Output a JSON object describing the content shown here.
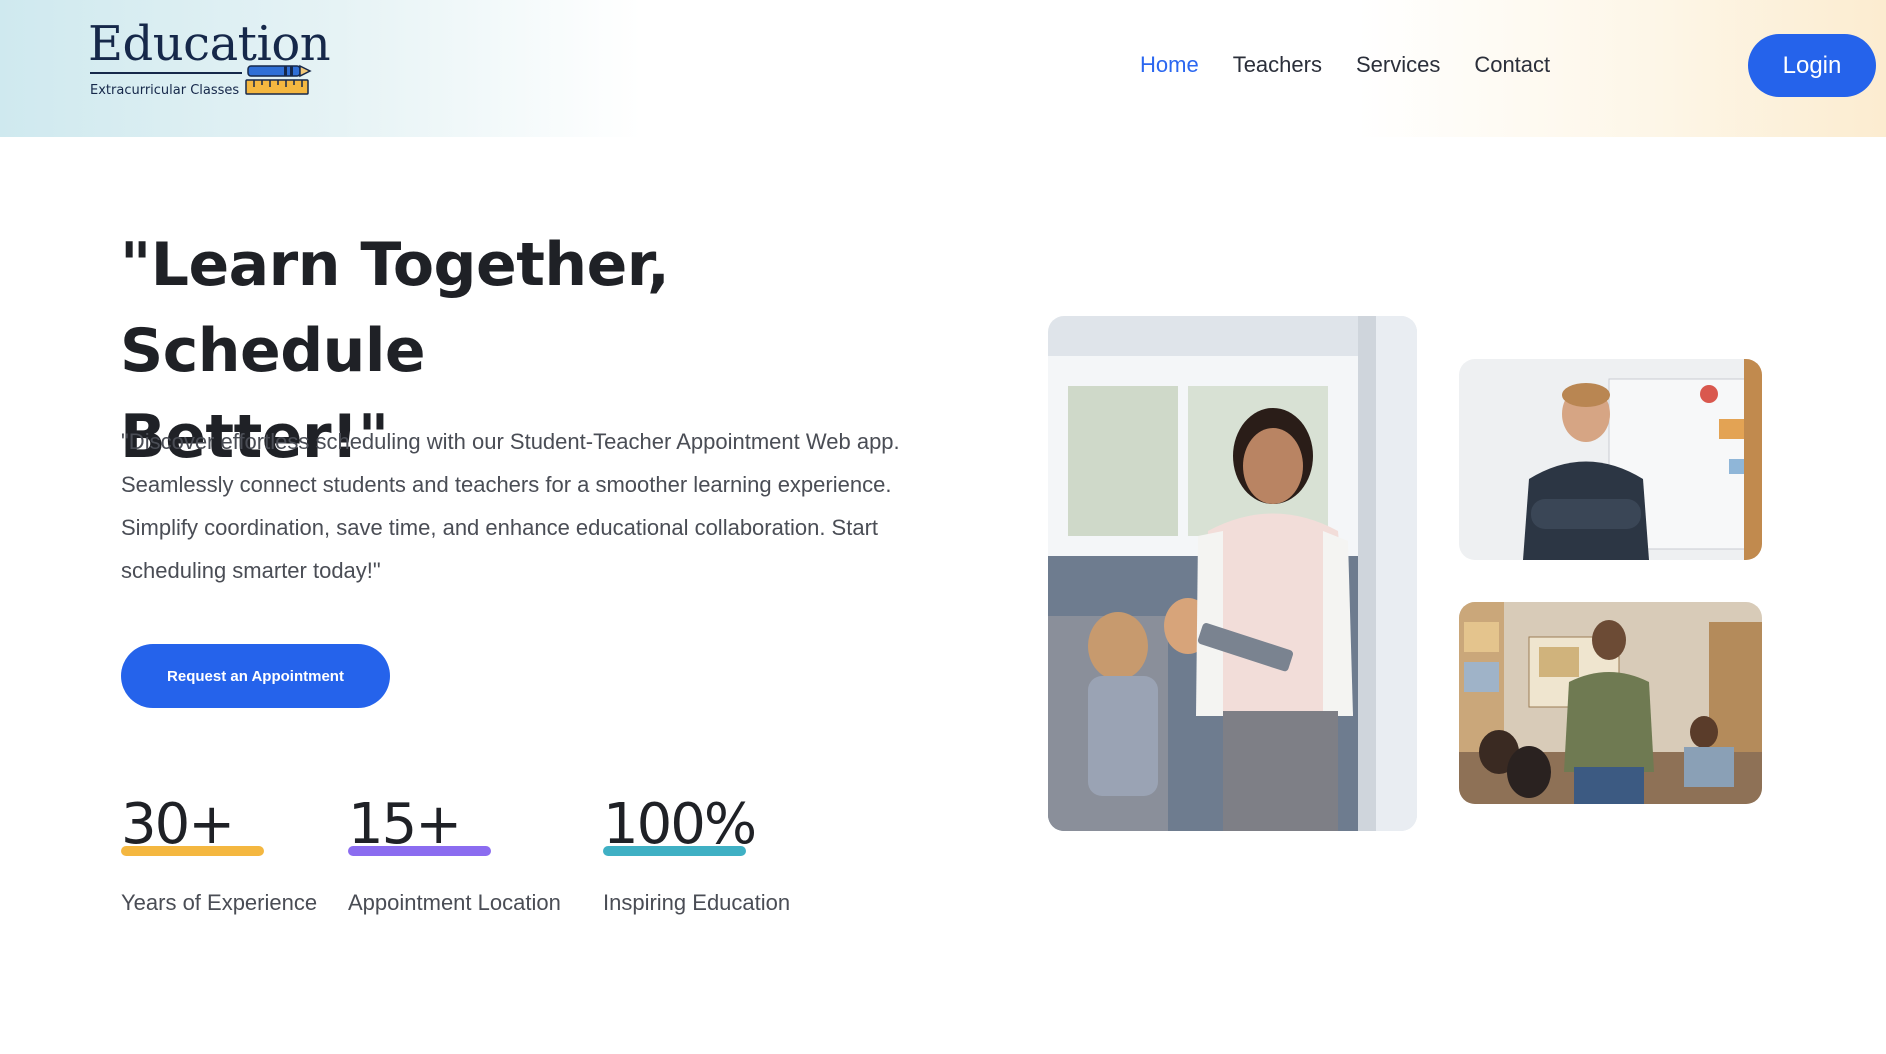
{
  "header": {
    "logo_title": "Education",
    "logo_subtitle": "Extracurricular Classes",
    "nav": [
      {
        "label": "Home",
        "active": true
      },
      {
        "label": "Teachers",
        "active": false
      },
      {
        "label": "Services",
        "active": false
      },
      {
        "label": "Contact",
        "active": false
      }
    ],
    "login_label": "Login"
  },
  "hero": {
    "title_line1": "\"Learn Together, Schedule",
    "title_line2": "Better!\"",
    "description": "\"Discover effortless scheduling with our Student-Teacher Appointment Web app. Seamlessly connect students and teachers for a smoother learning experience. Simplify coordination, save time, and enhance educational collaboration. Start scheduling smarter today!\"",
    "cta_label": "Request an Appointment"
  },
  "stats": [
    {
      "value": "30+",
      "label": "Years of Experience",
      "color": "#f4b740"
    },
    {
      "value": "15+",
      "label": "Appointment Location",
      "color": "#8b6cf0"
    },
    {
      "value": "100%",
      "label": "Inspiring Education",
      "color": "#3fb0c4"
    }
  ],
  "colors": {
    "accent": "#2563eb",
    "nav_active": "#2b67f0",
    "text_dark": "#1f2126",
    "text_body": "#4a4d55"
  }
}
